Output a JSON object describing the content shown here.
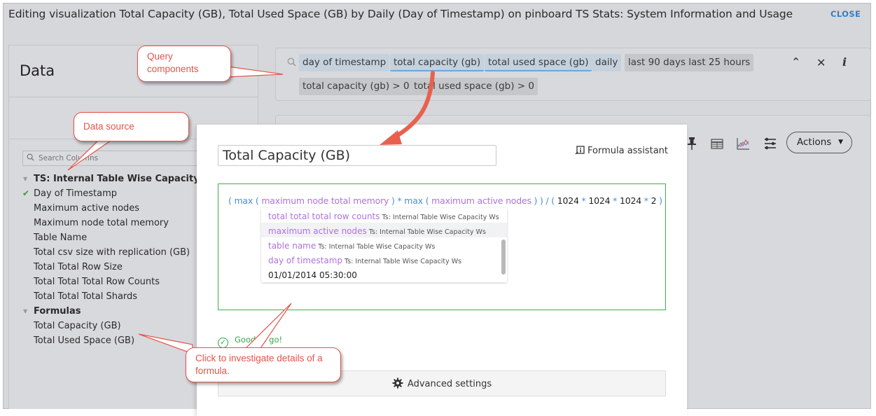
{
  "header": {
    "title": "Editing visualization Total Capacity (GB), Total Used Space (GB) by Daily (Day of Timestamp) on pinboard TS Stats: System Information and Usage",
    "close_label": "CLOSE",
    "close_color": "#2f7fcf"
  },
  "data_panel": {
    "title": "Data",
    "search_placeholder": "Search Columns",
    "groups": [
      {
        "label": "TS: Internal Table Wise Capacity WS",
        "items": [
          {
            "label": "Day of Timestamp",
            "checked": true
          },
          {
            "label": "Maximum active nodes",
            "checked": false
          },
          {
            "label": "Maximum node total memory",
            "checked": false
          },
          {
            "label": "Table Name",
            "checked": false
          },
          {
            "label": "Total csv size with replication (GB)",
            "checked": false
          },
          {
            "label": "Total Total Row Size",
            "checked": false
          },
          {
            "label": "Total Total Total Row Counts",
            "checked": false
          },
          {
            "label": "Total Total Total Shards",
            "checked": false
          }
        ]
      },
      {
        "label": "Formulas",
        "items": [
          {
            "label": "Total Capacity (GB)",
            "checked": false
          },
          {
            "label": "Total Used Space (GB)",
            "checked": false
          }
        ]
      }
    ]
  },
  "query_bar": {
    "tokens_row1": [
      "day of timestamp",
      "total capacity (gb)",
      "total used space (gb)",
      "daily",
      "last 90 days last 25 hours"
    ],
    "tokens_row2": [
      "total capacity (gb) > 0",
      "total used space (gb) > 0"
    ],
    "icons": [
      "chevron-up-icon",
      "clear-icon",
      "info-icon"
    ]
  },
  "viz_toolbar": {
    "icons": [
      "pin-icon",
      "table-icon",
      "chart-icon",
      "settings-sliders-icon"
    ],
    "actions_label": "Actions"
  },
  "formula_editor": {
    "name_value": "Total Capacity (GB)",
    "assistant_label": "Formula assistant",
    "formula_tokens": [
      {
        "t": "( max ( ",
        "k": "kw"
      },
      {
        "t": "maximum node total memory",
        "k": "col"
      },
      {
        "t": " ) * max ( ",
        "k": "kw"
      },
      {
        "t": "maximum active nodes",
        "k": "col"
      },
      {
        "t": " ) ) / ( ",
        "k": "kw"
      },
      {
        "t": "1024",
        "k": "num"
      },
      {
        "t": " * ",
        "k": "kw"
      },
      {
        "t": "1024",
        "k": "num"
      },
      {
        "t": " * ",
        "k": "kw"
      },
      {
        "t": "1024",
        "k": "num"
      },
      {
        "t": " * ",
        "k": "kw"
      },
      {
        "t": "2",
        "k": "num"
      },
      {
        "t": " )",
        "k": "kw"
      }
    ],
    "suggestions": [
      {
        "column": "total total total row counts",
        "source": "Ts: Internal Table Wise Capacity Ws",
        "highlighted": false
      },
      {
        "column": "maximum active nodes",
        "source": "Ts: Internal Table Wise Capacity Ws",
        "highlighted": true
      },
      {
        "column": "table name",
        "source": "Ts: Internal Table Wise Capacity Ws",
        "highlighted": false
      },
      {
        "column": "day of timestamp",
        "source": "Ts: Internal Table Wise Capacity Ws",
        "highlighted": false
      },
      {
        "value": "01/01/2014 05:30:00"
      }
    ],
    "status": "Good to go!",
    "advanced_label": "Advanced settings"
  },
  "callouts": {
    "query": "Query components",
    "source": "Data source",
    "formula": "Click to investigate details of a formula."
  },
  "colors": {
    "accent_red": "#e5534b",
    "valid_green": "#38b24a",
    "keyword_blue": "#4a8ed8",
    "column_purple": "#b071e0"
  }
}
